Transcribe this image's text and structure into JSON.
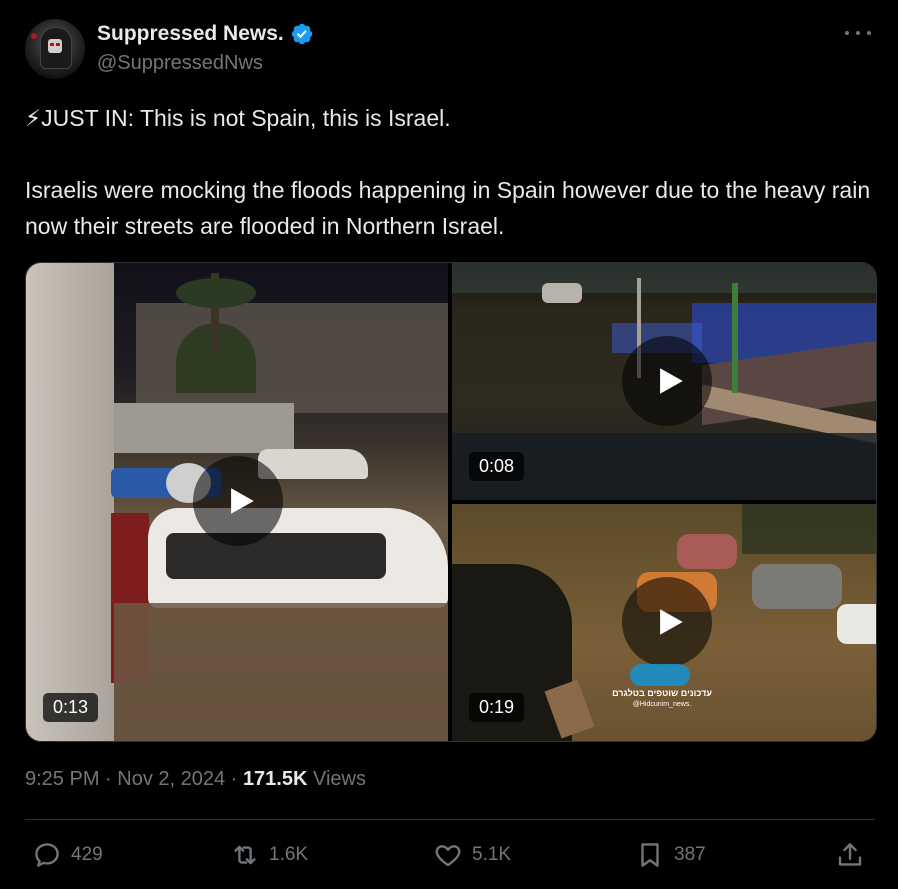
{
  "author": {
    "display_name": "Suppressed News.",
    "handle": "@SuppressedNws",
    "verified_color": "#1d9bf0"
  },
  "tweet": {
    "line1": "⚡JUST IN: This is not Spain, this is Israel.",
    "line2": "Israelis were mocking the floods happening in Spain however due to the heavy rain now their streets are flooded in Northern Israel."
  },
  "media": [
    {
      "duration": "0:13",
      "icon": "play-icon"
    },
    {
      "duration": "0:08",
      "icon": "play-icon"
    },
    {
      "duration": "0:19",
      "icon": "play-icon"
    }
  ],
  "watermark": {
    "line1": "עדכונים שוטפים בטלגרם",
    "line2": "@Hidcunim_news."
  },
  "meta": {
    "time": "9:25 PM",
    "separator": "·",
    "date": "Nov 2, 2024",
    "views_count": "171.5K",
    "views_label": "Views"
  },
  "actions": {
    "replies": "429",
    "reposts": "1.6K",
    "likes": "5.1K",
    "bookmarks": "387"
  },
  "colors": {
    "background": "#000000",
    "text": "#e7e9ea",
    "muted": "#71767b",
    "border": "#2f3336"
  }
}
